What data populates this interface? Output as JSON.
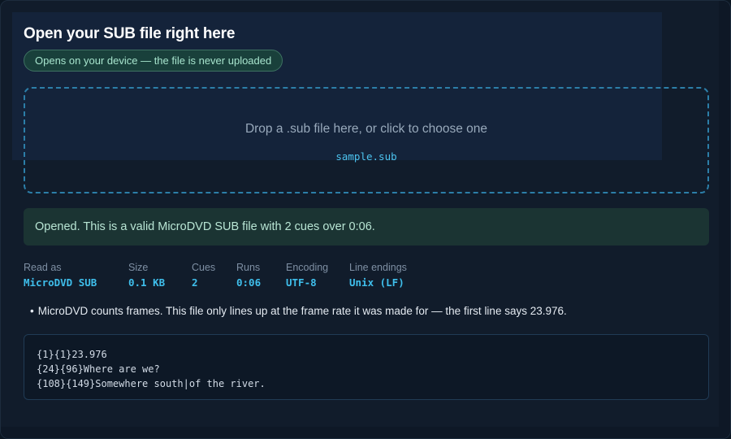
{
  "header": {
    "title": "Open your SUB file right here",
    "privacy_badge": "Opens on your device — the file is never uploaded"
  },
  "dropzone": {
    "prompt": "Drop a .sub file here, or click to choose one",
    "file_name": "sample.sub"
  },
  "status": {
    "message": "Opened. This is a valid MicroDVD SUB file with 2 cues over 0:06."
  },
  "meta": [
    {
      "label": "Read as",
      "value": "MicroDVD SUB"
    },
    {
      "label": "Size",
      "value": "0.1 KB"
    },
    {
      "label": "Cues",
      "value": "2"
    },
    {
      "label": "Runs",
      "value": "0:06"
    },
    {
      "label": "Encoding",
      "value": "UTF-8"
    },
    {
      "label": "Line endings",
      "value": "Unix (LF)"
    }
  ],
  "notes": [
    "MicroDVD counts frames. This file only lines up at the frame rate it was made for — the first line says 23.976."
  ],
  "preview": {
    "lines": [
      "{1}{1}23.976",
      "{24}{96}Where are we?",
      "{108}{149}Somewhere south|of the river."
    ]
  },
  "colors": {
    "background": "#111c2b",
    "accent": "#3fbfec",
    "success_bg": "#1b3433",
    "success_text": "#b8e5d4",
    "badge_border": "#3e7262"
  }
}
